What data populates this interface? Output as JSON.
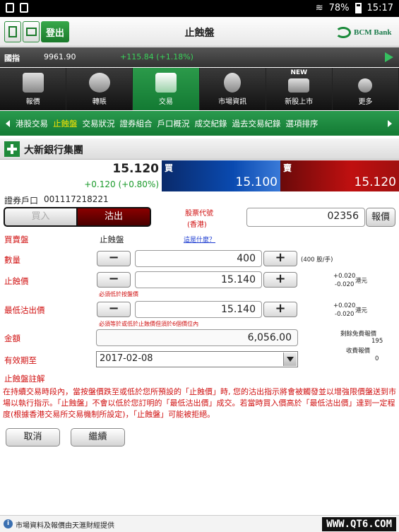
{
  "status": {
    "battery": "78%",
    "time": "15:17"
  },
  "titlebar": {
    "title": "止蝕盤",
    "logout": "登出",
    "bank_logo": "BCM Bank"
  },
  "ticker": {
    "name": "國指",
    "value": "9961.90",
    "change": "+115.84 (+1.18%)"
  },
  "nav": [
    {
      "label": "報價"
    },
    {
      "label": "轉賬"
    },
    {
      "label": "交易"
    },
    {
      "label": "市場資訊"
    },
    {
      "label": "新股上市",
      "badge": "NEW"
    },
    {
      "label": "更多"
    }
  ],
  "subnav": [
    "港股交易",
    "止蝕盤",
    "交易狀況",
    "證券組合",
    "戶口概況",
    "成交紀錄",
    "過去交易紀錄",
    "選項排序"
  ],
  "stock": {
    "name": "大新銀行集團",
    "last": "15.120",
    "change": "+0.120 (+0.80%)",
    "bid_label": "買",
    "bid": "15.100",
    "ask_label": "賣",
    "ask": "15.120"
  },
  "form": {
    "account_label": "證券戶口",
    "account_no": "001117218221",
    "buy": "買入",
    "sell": "沽出",
    "stock_code_label": "股票代號",
    "stock_code_sub": "(香港)",
    "stock_code": "02356",
    "quote_btn": "報價",
    "order_type_label": "買賣盤",
    "order_type": "止蝕盤",
    "what_link": "這是什麼？",
    "qty_label": "數量",
    "qty": "400",
    "qty_unit": "(400 股/手)",
    "stop_label": "止蝕價",
    "stop_price": "15.140",
    "stop_hint": "必須低於按盤價",
    "step_up": "+0.020",
    "step_down": "-0.020",
    "unit_hkd": "港元",
    "min_label": "最低沽出價",
    "min_price": "15.140",
    "min_hint": "必須等於或低於止蝕價但須於6個價位內",
    "amount_label": "金額",
    "amount": "6,056.00",
    "free_quotes_label": "剩餘免費報價",
    "free_quotes": "195",
    "paid_quotes_label": "收費報價",
    "paid_quotes": "0",
    "expiry_label": "有效期至",
    "expiry": "2017-02-08",
    "note_title": "止蝕盤註解",
    "note": "在持續交易時段內，當按盤價跌至或低於您所預設的「止蝕價」時, 您的沽出指示將會被觸發並以增強限價盤送到市場以執行指示。「止蝕盤」不會以低於您訂明的「最低沽出價」成交。若當時買入價高於「最低沽出價」達到一定程度(根據香港交易所交易機制所設定)，「止蝕盤」可能被拒絕。",
    "cancel": "取消",
    "continue": "繼續"
  },
  "footer": {
    "text": "市場資料及報價由天滙財經提供",
    "watermark": "WWW.QT6.COM"
  }
}
